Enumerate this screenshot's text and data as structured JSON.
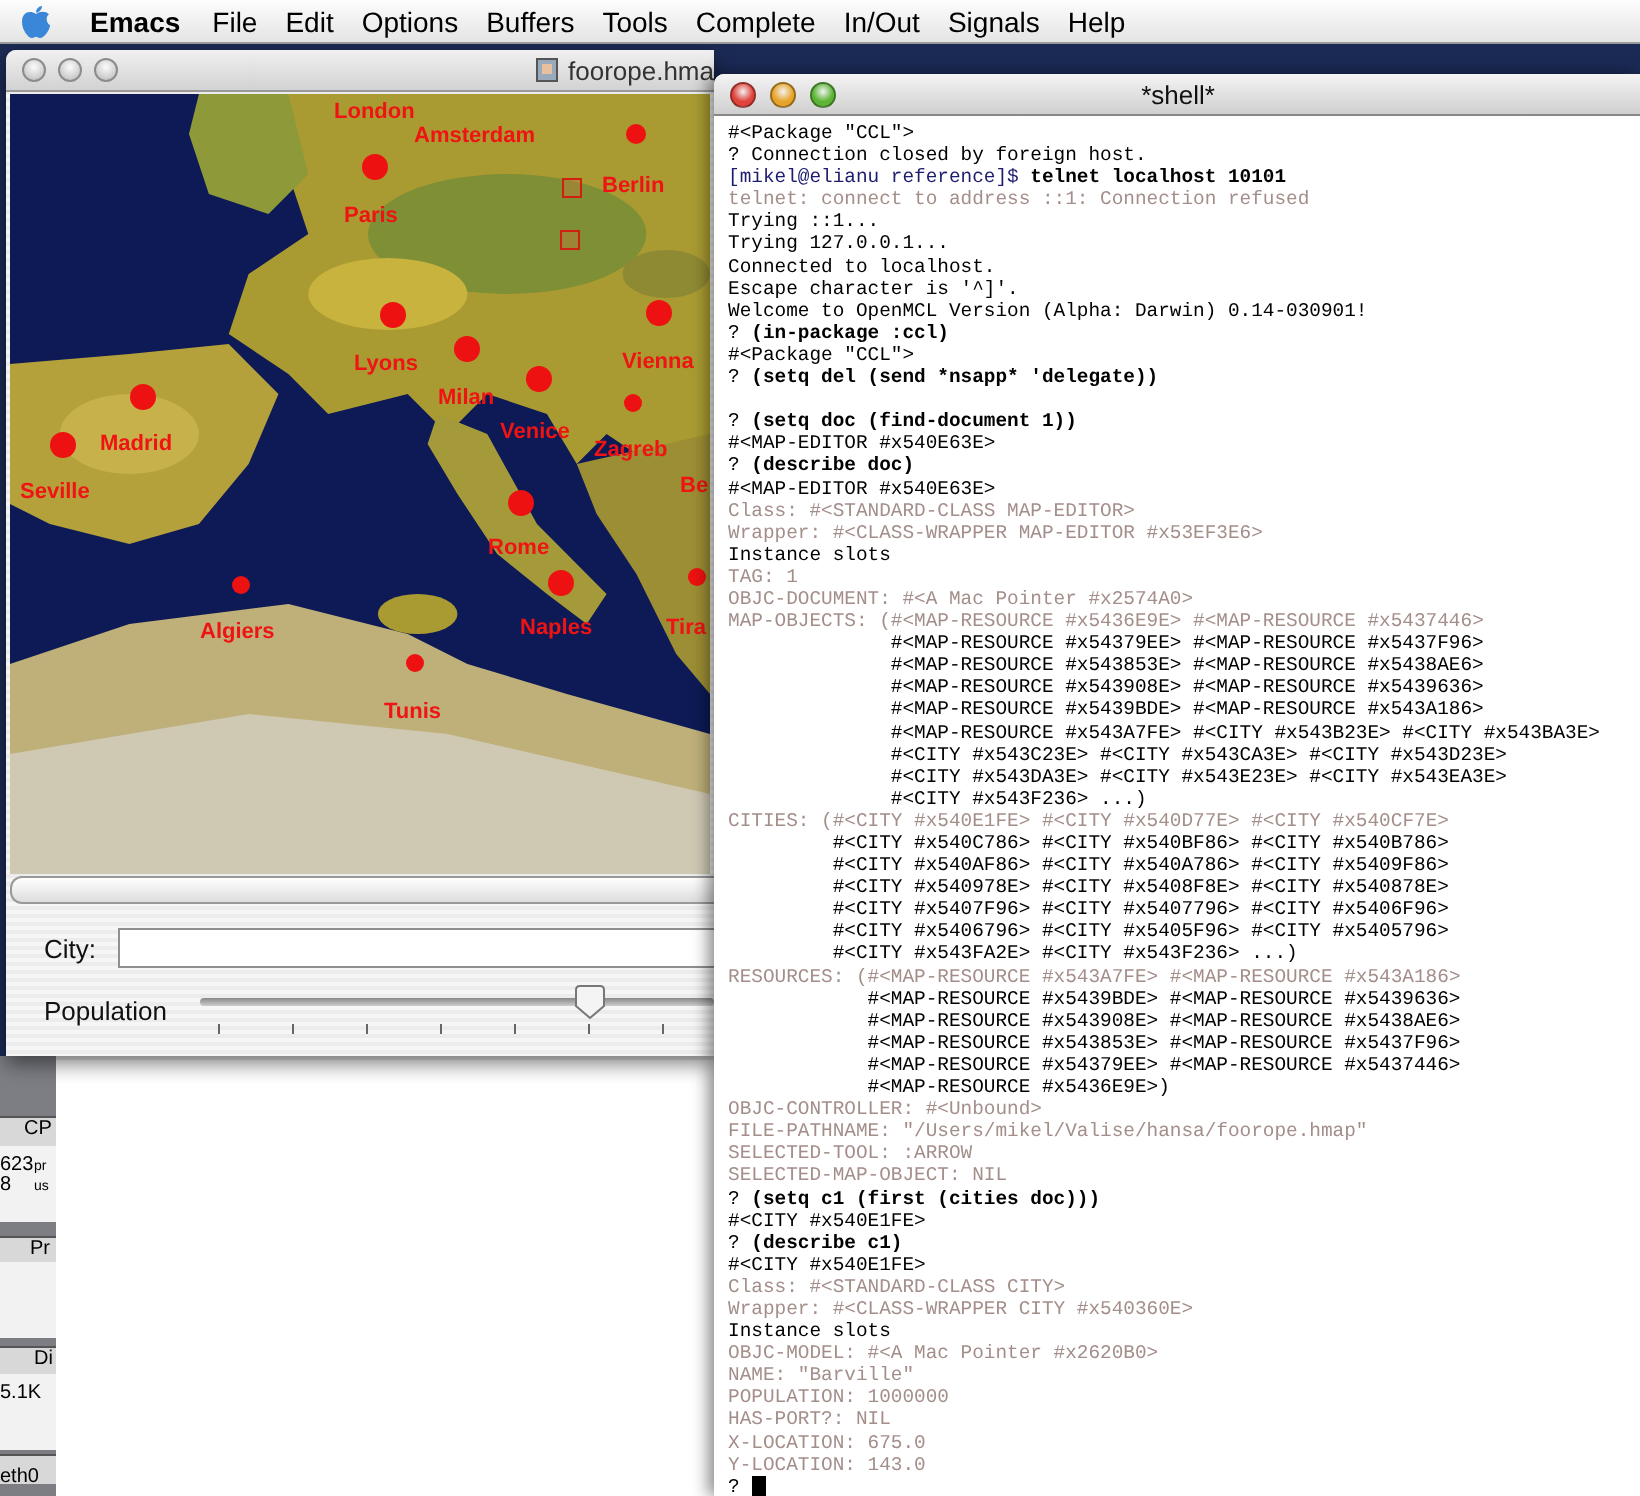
{
  "menu_bar": {
    "items": [
      {
        "label": "Emacs",
        "kind": "app"
      },
      {
        "label": "File",
        "kind": "menu"
      },
      {
        "label": "Edit",
        "kind": "menu"
      },
      {
        "label": "Options",
        "kind": "menu"
      },
      {
        "label": "Buffers",
        "kind": "menu"
      },
      {
        "label": "Tools",
        "kind": "menu"
      },
      {
        "label": "Complete",
        "kind": "menu"
      },
      {
        "label": "In/Out",
        "kind": "menu"
      },
      {
        "label": "Signals",
        "kind": "menu"
      },
      {
        "label": "Help",
        "kind": "menu"
      }
    ]
  },
  "monitor": {
    "texts": [
      "CP",
      "623",
      "pr",
      "8",
      "us",
      "Pr",
      "Di",
      "5.1K",
      "eth0"
    ]
  },
  "map_window": {
    "title": "foorope.hma",
    "cities": [
      {
        "name": "London"
      },
      {
        "name": "Amsterdam"
      },
      {
        "name": "Berlin"
      },
      {
        "name": "Paris"
      },
      {
        "name": "Lyons"
      },
      {
        "name": "Milan"
      },
      {
        "name": "Venice"
      },
      {
        "name": "Vienna"
      },
      {
        "name": "Zagreb"
      },
      {
        "name": "Madrid"
      },
      {
        "name": "Seville"
      },
      {
        "name": "Be"
      },
      {
        "name": "Rome"
      },
      {
        "name": "Algiers"
      },
      {
        "name": "Naples"
      },
      {
        "name": "Tira"
      },
      {
        "name": "Tunis"
      }
    ],
    "city_field": {
      "label": "City:"
    },
    "population": {
      "label": "Population",
      "level": 0.76
    }
  },
  "shell": {
    "title": "*shell*",
    "lines": [
      {
        "kind": "output",
        "text": "#<Package \"CCL\">"
      },
      {
        "kind": "output",
        "text": "? Connection closed by foreign host."
      },
      {
        "kind": "prompt",
        "prompt": "[mikel@elianu reference]$",
        "text": "telnet localhost 10101"
      },
      {
        "kind": "dim",
        "text": "telnet: connect to address ::1: Connection refused"
      },
      {
        "kind": "output",
        "text": "Trying ::1..."
      },
      {
        "kind": "output",
        "text": "Trying 127.0.0.1..."
      },
      {
        "kind": "output",
        "text": "Connected to localhost."
      },
      {
        "kind": "output",
        "text": "Escape character is '^]'."
      },
      {
        "kind": "output",
        "text": "Welcome to OpenMCL Version (Alpha: Darwin) 0.14-030901!"
      },
      {
        "kind": "input",
        "prompt": "?",
        "text": "(in-package :ccl)"
      },
      {
        "kind": "output",
        "text": "#<Package \"CCL\">"
      },
      {
        "kind": "input",
        "prompt": "?",
        "text": "(setq del (send *nsapp* 'delegate))"
      },
      {
        "kind": "blank"
      },
      {
        "kind": "input",
        "prompt": "?",
        "text": "(setq doc (find-document 1))"
      },
      {
        "kind": "output",
        "text": "#<MAP-EDITOR #x540E63E>"
      },
      {
        "kind": "input",
        "prompt": "?",
        "text": "(describe doc)"
      },
      {
        "kind": "output",
        "text": "#<MAP-EDITOR #x540E63E>"
      },
      {
        "kind": "dim",
        "text": "Class: #<STANDARD-CLASS MAP-EDITOR>"
      },
      {
        "kind": "dim",
        "text": "Wrapper: #<CLASS-WRAPPER MAP-EDITOR #x53EF3E6>"
      },
      {
        "kind": "output",
        "text": "Instance slots"
      },
      {
        "kind": "dim",
        "text": "TAG: 1"
      },
      {
        "kind": "dim",
        "text": "OBJC-DOCUMENT: #<A Mac Pointer #x2574A0>"
      },
      {
        "kind": "slot",
        "label": "MAP-OBJECTS:",
        "values": [
          "(#<MAP-RESOURCE #x5436E9E> #<MAP-RESOURCE #x5437446>",
          "#<MAP-RESOURCE #x54379EE> #<MAP-RESOURCE #x5437F96>",
          "#<MAP-RESOURCE #x543853E> #<MAP-RESOURCE #x5438AE6>",
          "#<MAP-RESOURCE #x543908E> #<MAP-RESOURCE #x5439636>",
          "#<MAP-RESOURCE #x5439BDE> #<MAP-RESOURCE #x543A186>",
          "#<MAP-RESOURCE #x543A7FE> #<CITY #x543B23E> #<CITY #x543BA3E>",
          "#<CITY #x543C23E> #<CITY #x543CA3E> #<CITY #x543D23E>",
          "#<CITY #x543DA3E> #<CITY #x543E23E> #<CITY #x543EA3E>",
          "#<CITY #x543F236> ...)"
        ]
      },
      {
        "kind": "slot",
        "label": "CITIES:",
        "values": [
          "(#<CITY #x540E1FE> #<CITY #x540D77E> #<CITY #x540CF7E>",
          "#<CITY #x540C786> #<CITY #x540BF86> #<CITY #x540B786>",
          "#<CITY #x540AF86> #<CITY #x540A786> #<CITY #x5409F86>",
          "#<CITY #x540978E> #<CITY #x5408F8E> #<CITY #x540878E>",
          "#<CITY #x5407F96> #<CITY #x5407796> #<CITY #x5406F96>",
          "#<CITY #x5406796> #<CITY #x5405F96> #<CITY #x5405796>",
          "#<CITY #x543FA2E> #<CITY #x543F236> ...)"
        ]
      },
      {
        "kind": "slot",
        "label": "RESOURCES:",
        "values": [
          "(#<MAP-RESOURCE #x543A7FE> #<MAP-RESOURCE #x543A186>",
          "#<MAP-RESOURCE #x5439BDE> #<MAP-RESOURCE #x5439636>",
          "#<MAP-RESOURCE #x543908E> #<MAP-RESOURCE #x5438AE6>",
          "#<MAP-RESOURCE #x543853E> #<MAP-RESOURCE #x5437F96>",
          "#<MAP-RESOURCE #x54379EE> #<MAP-RESOURCE #x5437446>",
          "#<MAP-RESOURCE #x5436E9E>)"
        ]
      },
      {
        "kind": "dim",
        "text": "OBJC-CONTROLLER: #<Unbound>"
      },
      {
        "kind": "dim",
        "text": "FILE-PATHNAME: \"/Users/mikel/Valise/hansa/foorope.hmap\""
      },
      {
        "kind": "dim",
        "text": "SELECTED-TOOL: :ARROW"
      },
      {
        "kind": "dim",
        "text": "SELECTED-MAP-OBJECT: NIL"
      },
      {
        "kind": "input",
        "prompt": "?",
        "text": "(setq c1 (first (cities doc)))"
      },
      {
        "kind": "output",
        "text": "#<CITY #x540E1FE>"
      },
      {
        "kind": "input",
        "prompt": "?",
        "text": "(describe c1)"
      },
      {
        "kind": "output",
        "text": "#<CITY #x540E1FE>"
      },
      {
        "kind": "dim",
        "text": "Class: #<STANDARD-CLASS CITY>"
      },
      {
        "kind": "dim",
        "text": "Wrapper: #<CLASS-WRAPPER CITY #x540360E>"
      },
      {
        "kind": "output",
        "text": "Instance slots"
      },
      {
        "kind": "dim",
        "text": "OBJC-MODEL: #<A Mac Pointer #x2620B0>"
      },
      {
        "kind": "dim",
        "text": "NAME: \"Barville\""
      },
      {
        "kind": "dim",
        "text": "POPULATION: 1000000"
      },
      {
        "kind": "dim",
        "text": "HAS-PORT?: NIL"
      },
      {
        "kind": "dim",
        "text": "X-LOCATION: 675.0"
      },
      {
        "kind": "dim",
        "text": "Y-LOCATION: 143.0"
      },
      {
        "kind": "cursor",
        "prompt": "?"
      }
    ]
  }
}
